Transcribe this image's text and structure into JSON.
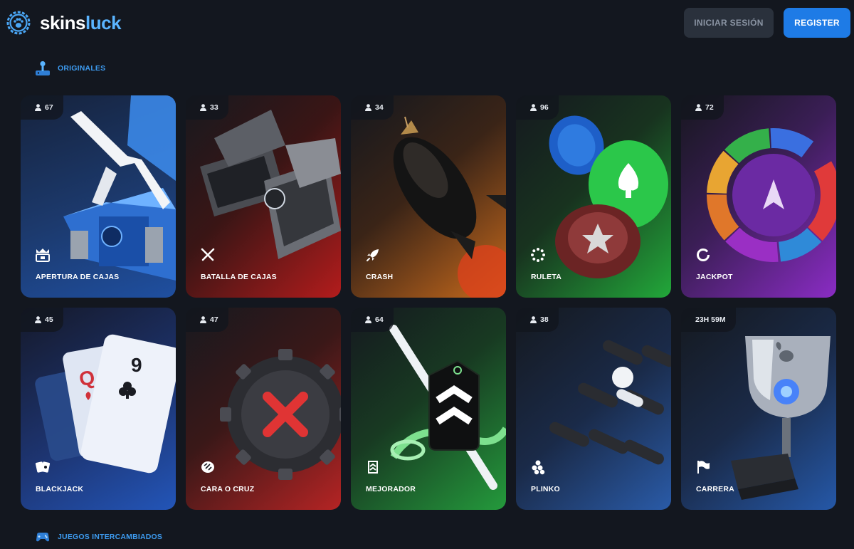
{
  "brand": {
    "name_part1": "skins",
    "name_part2": "luck"
  },
  "auth": {
    "login_label": "INICIAR SESIÓN",
    "register_label": "REGISTER"
  },
  "sections": {
    "originals": "ORIGINALES",
    "exchanged": "JUEGOS INTERCAMBIADOS"
  },
  "games": [
    {
      "label": "APERTURA DE CAJAS",
      "badge": "67",
      "icon": "crown-box-icon"
    },
    {
      "label": "BATALLA DE CAJAS",
      "badge": "33",
      "icon": "crossed-swords-icon"
    },
    {
      "label": "CRASH",
      "badge": "34",
      "icon": "rocket-icon"
    },
    {
      "label": "RULETA",
      "badge": "96",
      "icon": "roulette-dots-icon"
    },
    {
      "label": "JACKPOT",
      "badge": "72",
      "icon": "ring-icon"
    },
    {
      "label": "BLACKJACK",
      "badge": "45",
      "icon": "cards-icon"
    },
    {
      "label": "CARA O CRUZ",
      "badge": "47",
      "icon": "coin-icon"
    },
    {
      "label": "MEJORADOR",
      "badge": "64",
      "icon": "rank-chevrons-icon"
    },
    {
      "label": "PLINKO",
      "badge": "38",
      "icon": "balls-icon"
    },
    {
      "label": "CARRERA",
      "badge": "23H 59M",
      "icon": "flag-icon"
    }
  ],
  "colors": {
    "background": "#13171f",
    "accent": "#3d9bf0",
    "register": "#1e7be6"
  }
}
